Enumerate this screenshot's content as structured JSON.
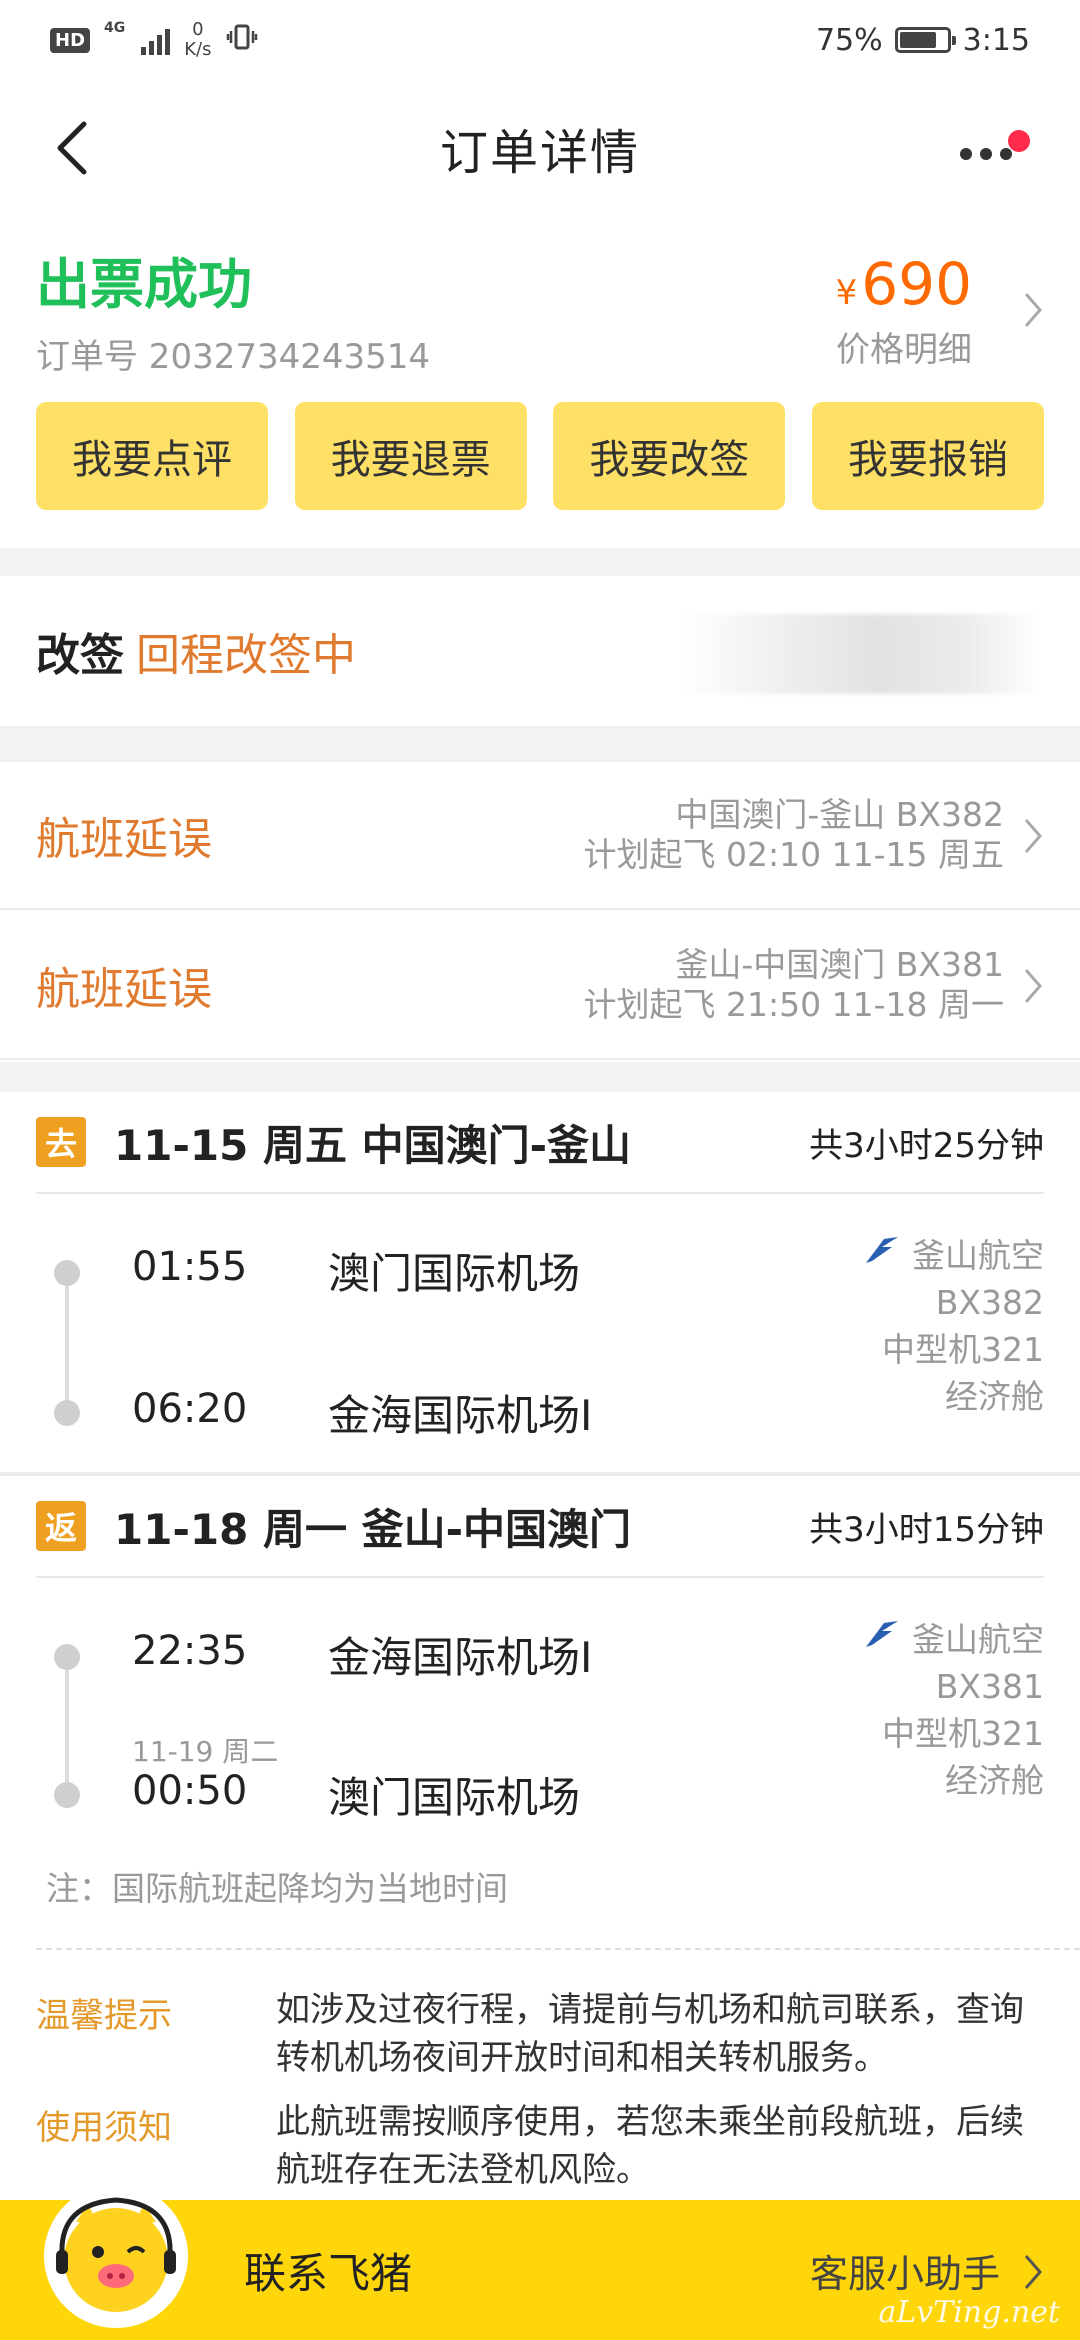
{
  "status_bar": {
    "hd": "HD",
    "network": "4G",
    "speed_value": "0",
    "speed_unit": "K/s",
    "battery": "75%",
    "time": "3:15"
  },
  "header": {
    "title": "订单详情"
  },
  "order": {
    "status": "出票成功",
    "order_no": "订单号 2032734243514",
    "currency": "¥",
    "price": "690",
    "price_detail": "价格明细"
  },
  "actions": [
    {
      "label": "我要点评"
    },
    {
      "label": "我要退票"
    },
    {
      "label": "我要改签"
    },
    {
      "label": "我要报销"
    }
  ],
  "change": {
    "label": "改签",
    "status": "回程改签中"
  },
  "delays": [
    {
      "label": "航班延误",
      "route": "中国澳门-釜山 BX382",
      "plan": "计划起飞 02:10 11-15 周五"
    },
    {
      "label": "航班延误",
      "route": "釜山-中国澳门 BX381",
      "plan": "计划起飞 21:50 11-18 周一"
    }
  ],
  "trips": [
    {
      "tag": "去",
      "route": "11-15 周五 中国澳门-釜山",
      "duration": "共3小时25分钟",
      "dep_time": "01:55",
      "dep_airport": "澳门国际机场",
      "arr_date": "",
      "arr_time": "06:20",
      "arr_airport": "金海国际机场I",
      "airline": "釜山航空",
      "flight": "BX382",
      "aircraft": "中型机321",
      "cabin": "经济舱"
    },
    {
      "tag": "返",
      "route": "11-18 周一 釜山-中国澳门",
      "duration": "共3小时15分钟",
      "dep_time": "22:35",
      "dep_airport": "金海国际机场I",
      "arr_date": "11-19 周二",
      "arr_time": "00:50",
      "arr_airport": "澳门国际机场",
      "airline": "釜山航空",
      "flight": "BX381",
      "aircraft": "中型机321",
      "cabin": "经济舱"
    }
  ],
  "note": "注：国际航班起降均为当地时间",
  "tips": [
    {
      "key": "温馨提示",
      "text": "如涉及过夜行程，请提前与机场和航司联系，查询转机机场夜间开放时间和相关转机服务。"
    },
    {
      "key": "使用须知",
      "text": "此航班需按顺序使用，若您未乘坐前段航班，后续航班存在无法登机风险。"
    }
  ],
  "bottom": {
    "contact": "联系飞猪",
    "helper": "客服小助手",
    "watermark": "aLvTing.net"
  },
  "colors": {
    "success": "#1fbf5a",
    "price": "#ff6a00",
    "warning": "#e07a2e",
    "button": "#ffe066",
    "bottom_bar": "#ffd60a",
    "tag": "#f0a020"
  },
  "icons": [
    "back-arrow-icon",
    "more-dots-icon",
    "notification-dot-icon",
    "chevron-right-icon",
    "airline-logo-icon",
    "mascot-icon"
  ]
}
